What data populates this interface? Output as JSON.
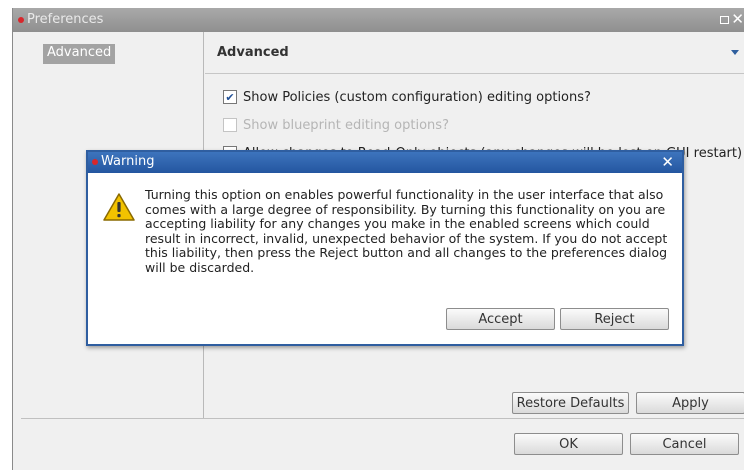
{
  "colors": {
    "window_dot": "#d8262b",
    "accent": "#2f5ea0",
    "warning_yellow": "#f2c200"
  },
  "preferences": {
    "title": "Preferences",
    "sidebar": {
      "items": [
        {
          "label": "Advanced",
          "selected": true
        }
      ]
    },
    "section": {
      "title": "Advanced"
    },
    "options": [
      {
        "label": "Show Policies (custom configuration) editing options?",
        "checked": true,
        "enabled": true
      },
      {
        "label": "Show blueprint editing options?",
        "checked": false,
        "enabled": false
      },
      {
        "label": "Allow changes to Read-Only objects (any changes will be lost on GUI restart)",
        "checked": false,
        "enabled": true
      }
    ],
    "buttons": {
      "restore_defaults": "Restore Defaults",
      "apply": "Apply",
      "ok": "OK",
      "cancel": "Cancel"
    }
  },
  "warning_dialog": {
    "title": "Warning",
    "close_glyph": "✕",
    "icon": "warning-triangle-icon",
    "message": "Turning this option on enables powerful functionality in the user interface that also comes with a large degree of responsibility. By turning this functionality on you are accepting liability for any changes you make in the enabled screens which could result in incorrect, invalid, unexpected behavior of the system. If you do not accept this liability, then press the Reject button and all changes to the preferences dialog will be discarded.",
    "buttons": {
      "accept": "Accept",
      "reject": "Reject"
    }
  }
}
